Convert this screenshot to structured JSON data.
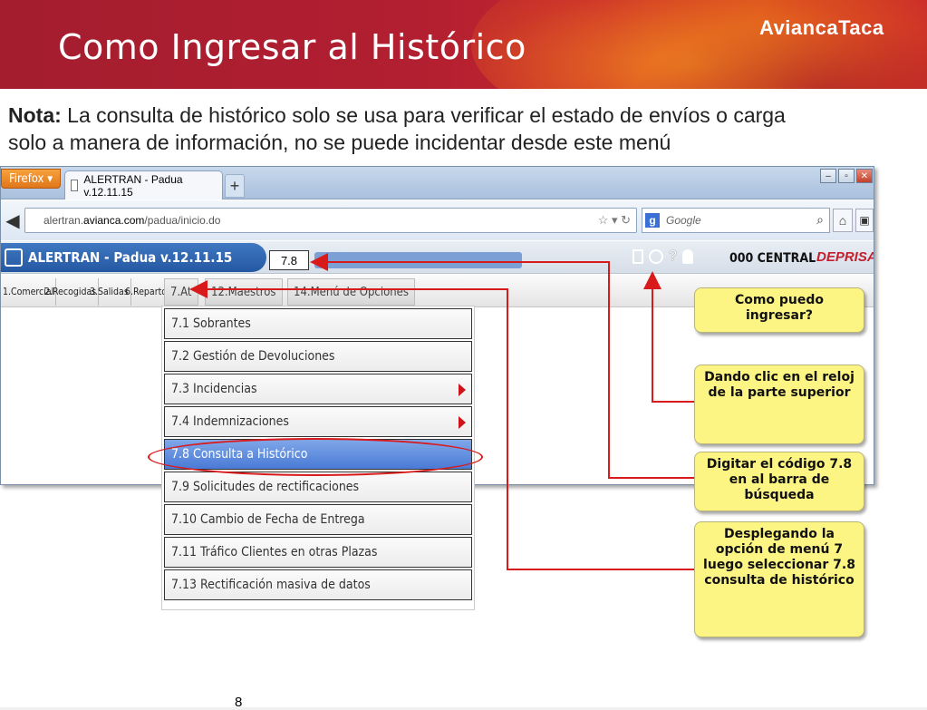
{
  "slide": {
    "title": "Como Ingresar al Histórico",
    "brand": "AviancaTaca",
    "note_label": "Nota:",
    "note_text": "La consulta de histórico solo se usa para verificar el estado de envíos o carga solo a manera de información, no se puede incidentar desde este menú",
    "page_number": "8"
  },
  "browser": {
    "firefox_button": "Firefox ▾",
    "tab_title": "ALERTRAN - Padua  v.12.11.15",
    "new_tab": "+",
    "url_domain": "alertran.",
    "url_host": "avianca.com",
    "url_path": "/padua/inicio.do",
    "search_placeholder": "Google"
  },
  "app": {
    "title": "ALERTRAN - Padua  v.12.11.15",
    "code_value": "7.8",
    "central": "000 CENTRAL",
    "logo": "DEPRISA"
  },
  "menubar": {
    "items": [
      "1.Comercial",
      "2.Recogidas",
      "3.Salidas",
      "6.Repartos",
      "7.At",
      "12.Maestros",
      "14.Menú de Opciones"
    ]
  },
  "dropdown": {
    "items": [
      {
        "label": "7.1 Sobrantes",
        "submenu": false,
        "selected": false
      },
      {
        "label": "7.2 Gestión de Devoluciones",
        "submenu": false,
        "selected": false
      },
      {
        "label": "7.3 Incidencias",
        "submenu": true,
        "selected": false
      },
      {
        "label": "7.4 Indemnizaciones",
        "submenu": true,
        "selected": false
      },
      {
        "label": "7.8 Consulta a Histórico",
        "submenu": false,
        "selected": true
      },
      {
        "label": "7.9 Solicitudes de rectificaciones",
        "submenu": false,
        "selected": false
      },
      {
        "label": "7.10 Cambio de Fecha de Entrega",
        "submenu": false,
        "selected": false
      },
      {
        "label": "7.11 Tráfico Clientes en otras Plazas",
        "submenu": false,
        "selected": false
      },
      {
        "label": "7.13 Rectificación masiva de datos",
        "submenu": false,
        "selected": false
      }
    ]
  },
  "callouts": {
    "question": "Como puedo ingresar?",
    "clock": "Dando clic en el reloj de la parte superior",
    "code": "Digitar el código 7.8 en al barra de búsqueda",
    "menu": "Desplegando la opción de menú 7 luego seleccionar 7.8 consulta de histórico"
  },
  "colors": {
    "header_red": "#b21f30",
    "accent_orange": "#f7941d",
    "callout_yellow": "#fcf584",
    "arrow_red": "#d91a1a",
    "app_blue": "#2f66b3"
  }
}
